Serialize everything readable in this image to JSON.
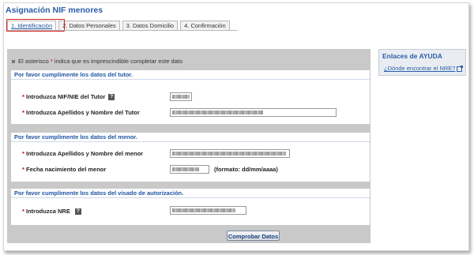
{
  "page": {
    "title": "Asignación NIF menores"
  },
  "tabs": [
    {
      "label": "1. Identificación",
      "active": true
    },
    {
      "label": "2. Datos Personales",
      "active": false
    },
    {
      "label": "3. Datos Domicilio",
      "active": false
    },
    {
      "label": "4. Confirmación",
      "active": false
    }
  ],
  "note": {
    "prefix": "El asterisco",
    "asterisk": "*",
    "suffix": "indica que es imprescindible completar este dato"
  },
  "sections": {
    "tutor": {
      "header": "Por favor cumplimente los datos del tutor.",
      "fields": [
        {
          "label": "Introduzca NIF/NIE del Tutor",
          "help": "?"
        },
        {
          "label": "Introduzca Apellidos y Nombre del Tutor"
        }
      ]
    },
    "menor": {
      "header": "Por favor cumplimente los datos del menor.",
      "fields": [
        {
          "label": "Introduzca Apellidos y Nombre del menor"
        },
        {
          "label": "Fecha nacimiento del menor",
          "format_hint": "(formato: dd/mm/aaaa)"
        }
      ]
    },
    "visado": {
      "header": "Por favor cumplimente los datos del visado de autorización.",
      "fields": [
        {
          "label": "Introduzca NRE",
          "help": "?"
        }
      ]
    }
  },
  "required_marker": "*",
  "actions": {
    "submit_label": "Comprobar Datos"
  },
  "help_panel": {
    "title": "Enlaces de AYUDA",
    "link": "¿Dónde encontrar el NRE?"
  },
  "colors": {
    "accent": "#2a5ea8",
    "required": "#d40000",
    "panel_bg": "#c9c9c9",
    "tab_highlight": "#d62020"
  }
}
